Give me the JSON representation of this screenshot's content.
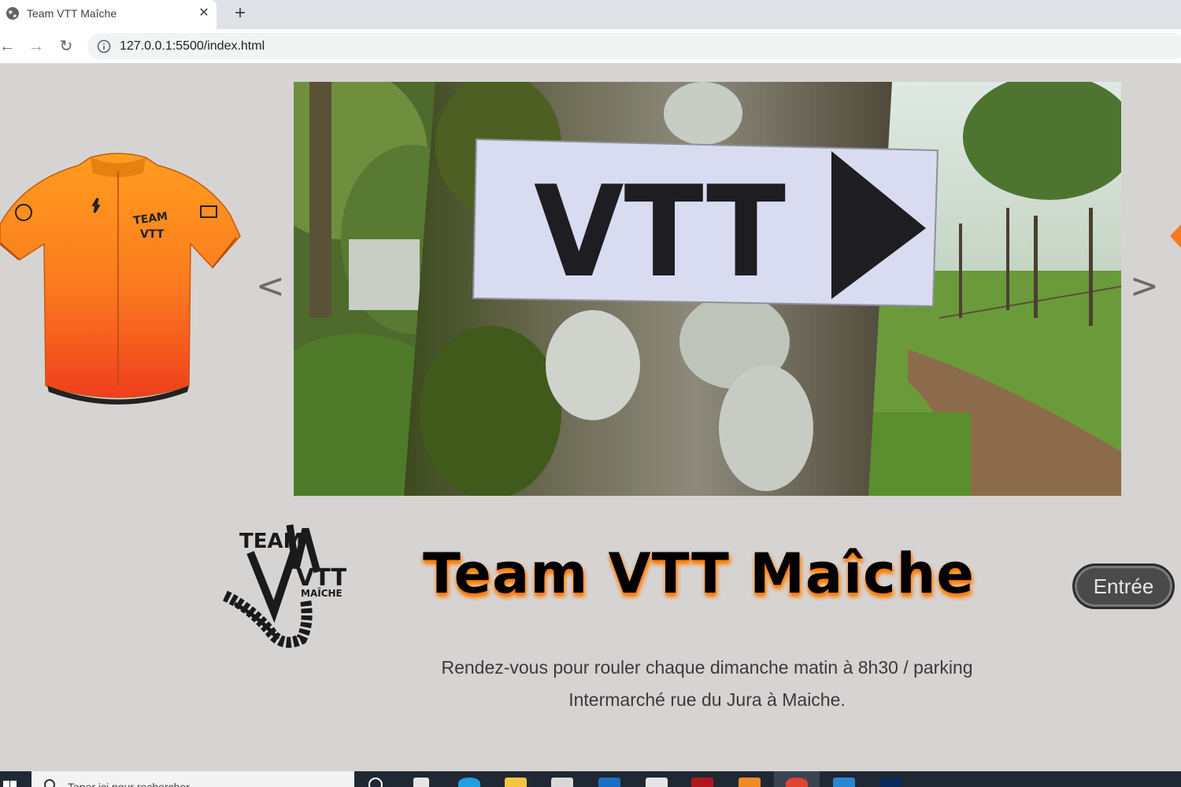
{
  "browser": {
    "tab": {
      "title": "Team VTT Maîche",
      "close_glyph": "✕"
    },
    "new_tab_glyph": "+",
    "nav": {
      "back_glyph": "←",
      "forward_glyph": "→",
      "reload_glyph": "↻"
    },
    "url": "127.0.0.1:5500/index.html"
  },
  "page": {
    "carousel": {
      "prev_label": "<",
      "next_label": ">",
      "sign_text": "VTT"
    },
    "logo_text": {
      "line1": "TEAM",
      "line2": "VTT",
      "line3": "MAÎCHE"
    },
    "title": "Team VTT Maîche",
    "enter_button": "Entrée",
    "info_line1": "Rendez-vous pour rouler chaque dimanche matin à 8h30 / parking",
    "info_line2": "Intermarché rue du Jura à Maiche."
  },
  "taskbar": {
    "search_placeholder": "Taper ici pour rechercher"
  },
  "colors": {
    "page_bg": "#d6d3d3",
    "title_glow": "#ff7a00",
    "jersey_top": "#ff9a1f",
    "jersey_bottom": "#f04a1e",
    "button_bg": "#4a4a4a"
  }
}
